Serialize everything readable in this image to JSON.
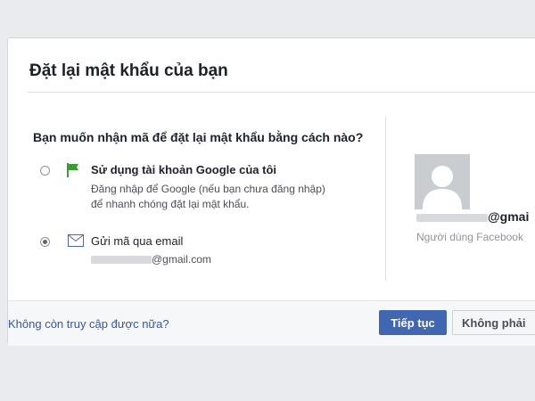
{
  "dialog": {
    "title": "Đặt lại mật khẩu của bạn",
    "question": "Bạn muốn nhận mã để đặt lại mật khẩu bằng cách nào?",
    "options": [
      {
        "icon": "google-flag-icon",
        "title": "Sử dụng tài khoản Google của tôi",
        "subtitle_line1": "Đăng nhập để Google (nếu bạn chưa đăng nhập)",
        "subtitle_line2": "để nhanh chóng đặt lại mật khẩu.",
        "selected": false
      },
      {
        "icon": "envelope-icon",
        "title": "Gửi mã qua email",
        "email_suffix": "@gmail.com",
        "selected": true
      }
    ],
    "user": {
      "email_suffix": "@gmai",
      "role": "Người dùng Facebook"
    },
    "footer": {
      "link": "Không còn truy cập được nữa?",
      "continue_label": "Tiếp tục",
      "not_you_label": "Không phải"
    }
  },
  "colors": {
    "primary": "#4267b2",
    "link": "#365899",
    "background": "#e9ebee",
    "google_green": "#3d9b35"
  }
}
